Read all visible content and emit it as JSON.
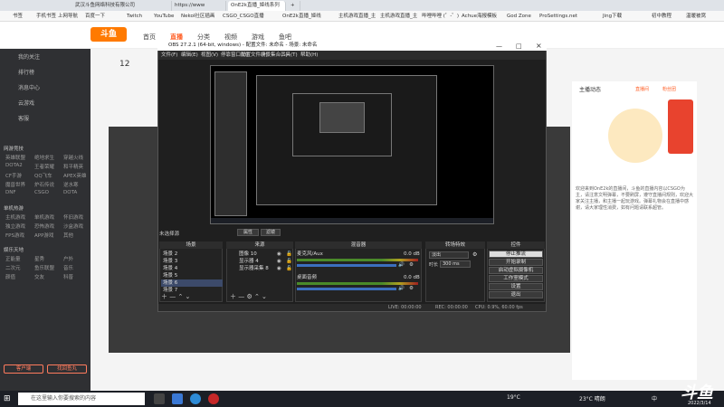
{
  "browser": {
    "tabs": [
      "武汉斗鱼网络科技有限公司",
      "https://www",
      "OnE2k直播_姬线系列",
      ""
    ],
    "bookmarks": [
      "书签",
      "手机书签",
      "上网导航",
      "百度一下",
      "Twitch",
      "YouTube",
      "Nekol社区插画",
      "CSGO_CSGO直播",
      "OnE2k直播_姬线",
      "主机游戏直播_主",
      "主机游戏直播_主",
      "哔哩哔哩 (゜-゜)",
      "Achue海报模板",
      "God Zone",
      "ProSettings.net",
      "Jing下载",
      "初中教程",
      "温暖被窝"
    ]
  },
  "site": {
    "logo": "斗鱼",
    "nav": [
      "首页",
      "直播",
      "分类",
      "视频",
      "游戏",
      "鱼吧"
    ],
    "active_nav": "直播",
    "viewer_count": "12",
    "sidebar_top": [
      "我的关注",
      "排行榜",
      "消息中心",
      "云游戏",
      "客服"
    ],
    "sidebar_sections": [
      {
        "head": "网游竞技",
        "items": [
          "英雄联盟",
          "绝地求生",
          "穿越火线",
          "DOTA2",
          "王者荣耀",
          "和平精英",
          "CF手游",
          "QQ飞车",
          "APEX英雄",
          "魔兽世界",
          "炉石传说",
          "逆水寒",
          "DNF",
          "CSGO",
          "DOTA",
          "剑网3"
        ]
      },
      {
        "head": "单机热游",
        "items": [
          "主机游戏",
          "单机游戏",
          "怀旧游戏",
          "独立游戏",
          "恐怖游戏",
          "沙盒游戏",
          "FPS游戏",
          "APP游戏",
          "其他"
        ]
      },
      {
        "head": "娱乐天地",
        "items": [
          "正能量",
          "星秀",
          "户外",
          "二次元",
          "鱼乐联盟",
          "音乐",
          "颜值",
          "交友",
          "科普",
          "美食"
        ]
      }
    ],
    "sidebar_buttons": [
      "客户端",
      "找回鱼丸"
    ],
    "right_panel": {
      "heading": "主播动态",
      "tags": [
        "直播间",
        "粉丝团"
      ],
      "body": "欢迎来到OnE2k的直播间，斗鱼的直播内容以CSGO为主，请注意文明弹幕，不要刷屏，遵守直播间规则，欢迎大家关注主播，和主播一起玩游戏。弹幕礼物会在直播中感谢，请大家理性消费，如有问题请联系超管。"
    }
  },
  "obs": {
    "title": "OBS 27.2.1 (64-bit, windows) - 配置文件: 未命名 - 场景: 未命名",
    "menu": [
      "文件(F)",
      "编辑(E)",
      "视图(V)",
      "停靠窗口(D)",
      "配置文件(P)",
      "场景集合(S)",
      "工具(T)",
      "帮助(H)"
    ],
    "no_source": "未选择源",
    "props_btn": "属性",
    "filter_btn": "滤镜",
    "docks": {
      "scenes": "场景",
      "sources": "来源",
      "mixer": "混音器",
      "transitions": "转场特效",
      "controls": "控件"
    },
    "scenes": [
      "场景 2",
      "场景 3",
      "场景 4",
      "场景 5",
      "场景 6",
      "场景 7"
    ],
    "selected_scene": "场景 6",
    "sources": [
      "图像 10",
      "显示器 4",
      "显示器采集 8"
    ],
    "mixer": [
      {
        "name": "麦克风/Aux",
        "db": "0.0 dB"
      },
      {
        "name": "桌面音频",
        "db": "0.0 dB"
      }
    ],
    "transition": {
      "type": "淡出",
      "duration_label": "时长",
      "duration": "300 ms"
    },
    "controls": [
      "停止推流",
      "开始录制",
      "启动虚拟摄像机",
      "工作室模式",
      "设置",
      "退出"
    ],
    "status": {
      "live": "LIVE: 00:00:00",
      "rec": "REC: 00:00:00",
      "cpu": "CPU: 0.9%, 60.00 fps"
    }
  },
  "taskbar": {
    "search_placeholder": "在这里输入你要搜索的内容",
    "weather": "19°C",
    "temp2": "23°C 晴朗",
    "ime": "中",
    "time": "2022/3/14"
  },
  "watermark": "斗鱼"
}
